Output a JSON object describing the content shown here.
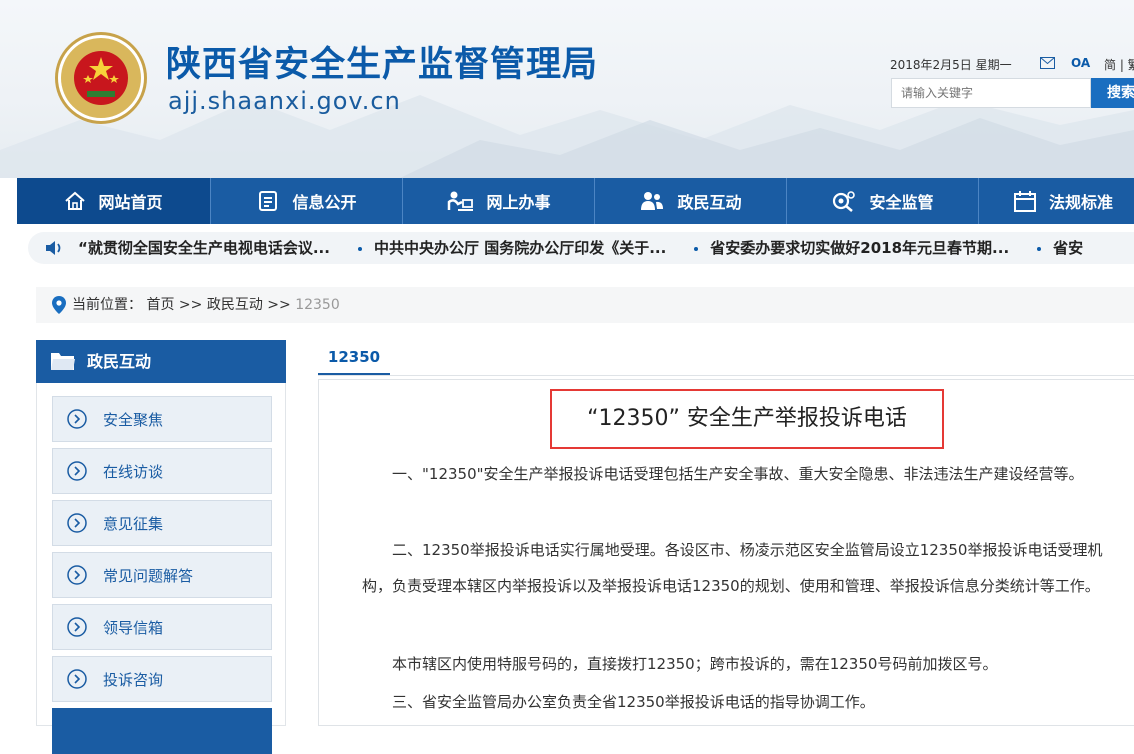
{
  "header": {
    "site_title": "陕西省安全生产监督管理局",
    "site_domain": "ajj.shaanxi.gov.cn",
    "date": "2018年2月5日 星期一",
    "oa_label": "OA",
    "lang_label": "简 | 繁",
    "search_placeholder": "请输入关键字",
    "search_button": "搜索",
    "colors": {
      "brand": "#1a5ca3",
      "accent_red": "#e53935"
    }
  },
  "nav": {
    "items": [
      {
        "label": "网站首页",
        "icon": "home-icon"
      },
      {
        "label": "信息公开",
        "icon": "document-list-icon"
      },
      {
        "label": "网上办事",
        "icon": "desk-user-icon"
      },
      {
        "label": "政民互动",
        "icon": "users-icon"
      },
      {
        "label": "安全监管",
        "icon": "magnifier-gear-icon"
      },
      {
        "label": "法规标准",
        "icon": "calendar-icon"
      }
    ]
  },
  "ticker": {
    "items": [
      "“就贯彻全国安全生产电视电话会议...",
      "中共中央办公厅 国务院办公厅印发《关于...",
      "省安委办要求切实做好2018年元旦春节期...",
      "省安"
    ]
  },
  "breadcrumb": {
    "prefix": "当前位置：",
    "home": "首页",
    "sep": ">>",
    "section": "政民互动",
    "current": "12350"
  },
  "sidebar": {
    "title": "政民互动",
    "items": [
      {
        "label": "安全聚焦"
      },
      {
        "label": "在线访谈"
      },
      {
        "label": "意见征集"
      },
      {
        "label": "常见问题解答"
      },
      {
        "label": "领导信箱"
      },
      {
        "label": "投诉咨询"
      },
      {
        "label": ""
      }
    ]
  },
  "content": {
    "tab": "12350",
    "title": "“12350” 安全生产举报投诉电话",
    "paragraphs": [
      "一、\"12350\"安全生产举报投诉电话受理包括生产安全事故、重大安全隐患、非法违法生产建设经营等。",
      "二、12350举报投诉电话实行属地受理。各设区市、杨凌示范区安全监管局设立12350举报投诉电话受理机构，负责受理本辖区内举报投诉以及举报投诉电话12350的规划、使用和管理、举报投诉信息分类统计等工作。",
      "本市辖区内使用特服号码的，直接拨打12350；跨市投诉的，需在12350号码前加拨区号。",
      "三、省安全监管局办公室负责全省12350举报投诉电话的指导协调工作。"
    ]
  }
}
